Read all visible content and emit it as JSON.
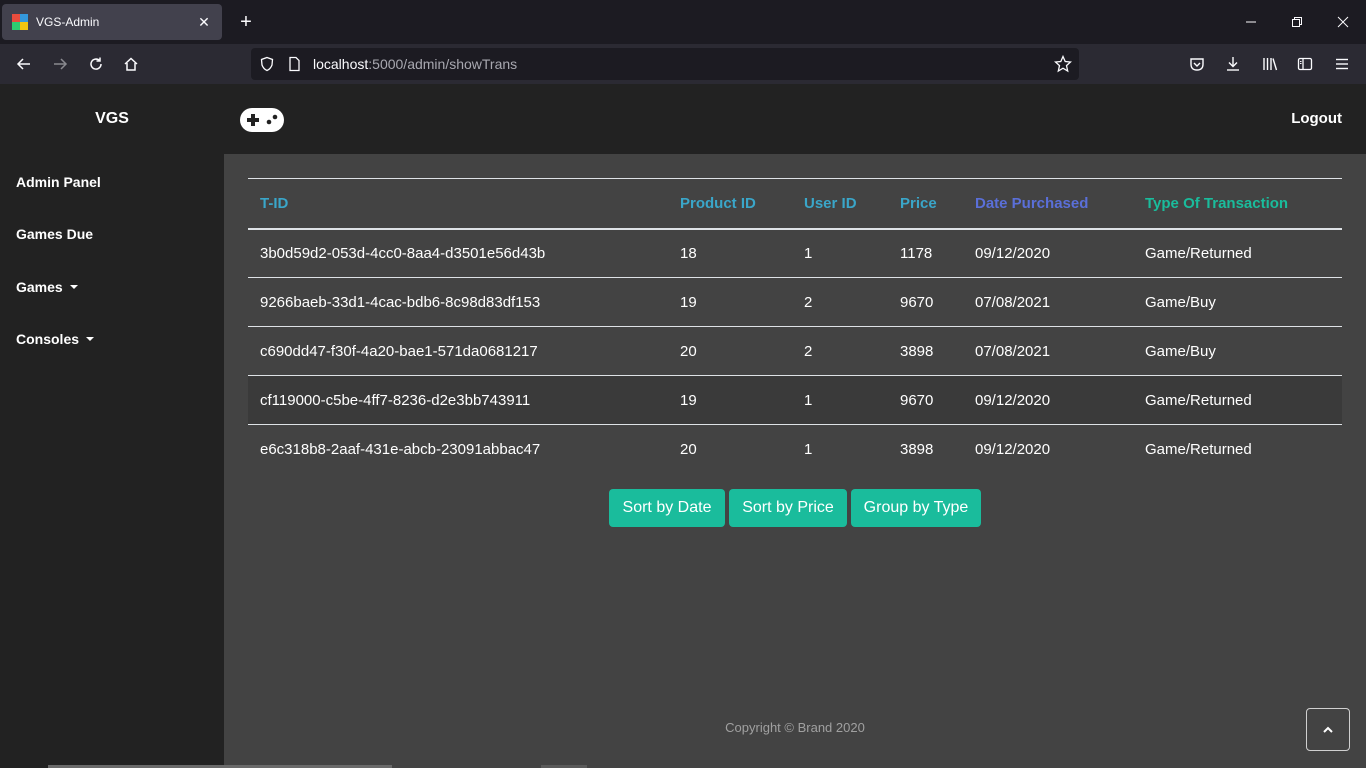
{
  "browser": {
    "tab_title": "VGS-Admin",
    "url_host": "localhost",
    "url_rest": ":5000/admin/showTrans"
  },
  "sidebar": {
    "brand": "VGS",
    "items": [
      {
        "label": "Admin Panel",
        "dropdown": false
      },
      {
        "label": "Games Due",
        "dropdown": false
      },
      {
        "label": "Games",
        "dropdown": true
      },
      {
        "label": "Consoles",
        "dropdown": true
      }
    ]
  },
  "topbar": {
    "logout_label": "Logout"
  },
  "table": {
    "headers": [
      {
        "label": "T-ID",
        "color": "#3aa6c9"
      },
      {
        "label": "Product ID",
        "color": "#3aa6c9"
      },
      {
        "label": "User ID",
        "color": "#3aa6c9"
      },
      {
        "label": "Price",
        "color": "#3aa6c9"
      },
      {
        "label": "Date Purchased",
        "color": "#5a6fd8"
      },
      {
        "label": "Type Of Transaction",
        "color": "#1abc9c"
      }
    ],
    "rows": [
      [
        "3b0d59d2-053d-4cc0-8aa4-d3501e56d43b",
        "18",
        "1",
        "1178",
        "09/12/2020",
        "Game/Returned"
      ],
      [
        "9266baeb-33d1-4cac-bdb6-8c98d83df153",
        "19",
        "2",
        "9670",
        "07/08/2021",
        "Game/Buy"
      ],
      [
        "c690dd47-f30f-4a20-bae1-571da0681217",
        "20",
        "2",
        "3898",
        "07/08/2021",
        "Game/Buy"
      ],
      [
        "cf119000-c5be-4ff7-8236-d2e3bb743911",
        "19",
        "1",
        "9670",
        "09/12/2020",
        "Game/Returned"
      ],
      [
        "e6c318b8-2aaf-431e-abcb-23091abbac47",
        "20",
        "1",
        "3898",
        "09/12/2020",
        "Game/Returned"
      ]
    ]
  },
  "actions": {
    "sort_date": "Sort by Date",
    "sort_price": "Sort by Price",
    "group_type": "Group by Type"
  },
  "footer": {
    "copyright": "Copyright © Brand 2020"
  },
  "colors": {
    "accent": "#1abc9c",
    "header_blue": "#3aa6c9",
    "header_indigo": "#5a6fd8"
  }
}
